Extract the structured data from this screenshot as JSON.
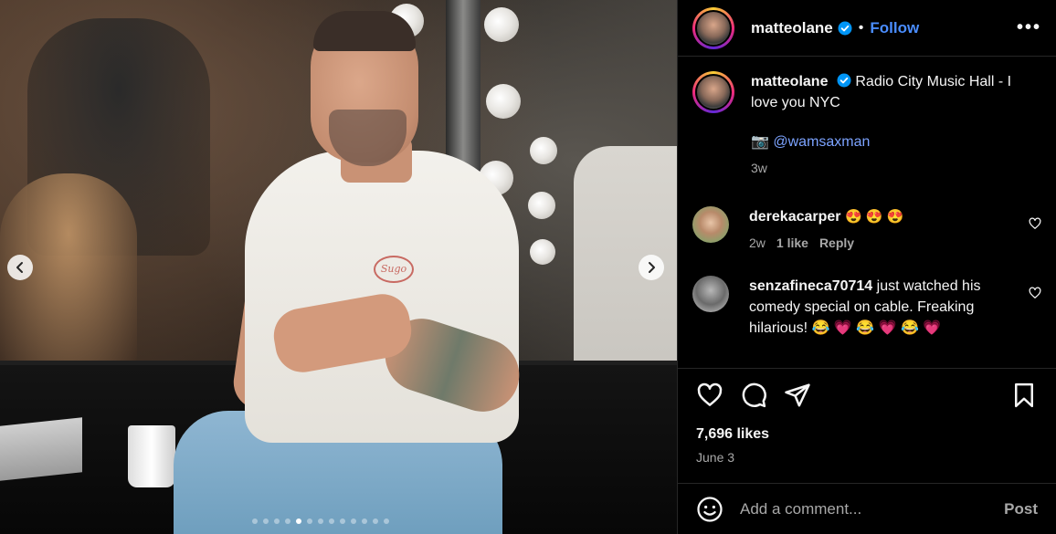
{
  "post": {
    "username": "matteolane",
    "separator": "•",
    "follow_label": "Follow",
    "more_label": "•••",
    "verified_icon": "verified-badge-icon",
    "brand_color": "#4a8dff",
    "carousel": {
      "total_slides": 13,
      "active_index": 4
    }
  },
  "caption": {
    "username": "matteolane",
    "text": "Radio City Music Hall - I love you NYC",
    "camera_emoji": "📷",
    "mention": "@wamsaxman",
    "time": "3w"
  },
  "comments": [
    {
      "username": "derekacarper",
      "text": "😍 😍 😍",
      "time": "2w",
      "likes": "1 like",
      "reply": "Reply"
    },
    {
      "username": "senzafineca70714",
      "text": "just watched his comedy special on cable. Freaking hilarious! 😂 💗 😂 💗 😂 💗"
    }
  ],
  "stats": {
    "likes": "7,696 likes",
    "date": "June 3"
  },
  "composer": {
    "placeholder": "Add a comment...",
    "post_label": "Post"
  },
  "photo": {
    "shirt_logo_text": "Sugo"
  }
}
